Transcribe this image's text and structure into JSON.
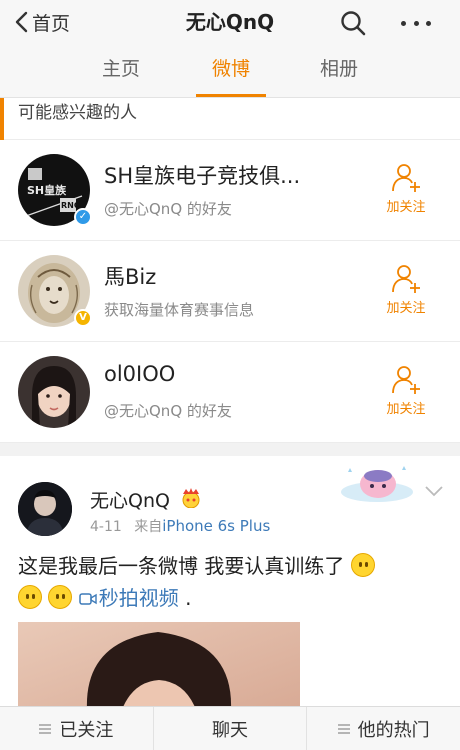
{
  "nav": {
    "back_label": "首页",
    "title": "无心QnQ"
  },
  "tabs": [
    {
      "label": "主页"
    },
    {
      "label": "微博"
    },
    {
      "label": "相册"
    }
  ],
  "suggest": {
    "title": "可能感兴趣的人",
    "follow_label": "加关注",
    "people": [
      {
        "name": "SH皇族电子竞技俱...",
        "subtitle": "@无心QnQ 的好友",
        "verified": "blue"
      },
      {
        "name": "馬Biz",
        "subtitle": "获取海量体育赛事信息",
        "verified": "gold"
      },
      {
        "name": "ol0IOO",
        "subtitle": "@无心QnQ 的好友",
        "verified": "none"
      }
    ],
    "avatar_logo_text": [
      "SH皇族",
      "RNG"
    ]
  },
  "post": {
    "author": "无心QnQ",
    "date": "4-11",
    "source_prefix": "来自",
    "source": "iPhone 6s Plus",
    "text": "这是我最后一条微博 我要认真训练了",
    "video_link": "秒拍视频",
    "trailing": "."
  },
  "bottom": {
    "followed": "已关注",
    "chat": "聊天",
    "hot": "他的热门"
  },
  "colors": {
    "accent": "#f08300",
    "link": "#3d7ab8",
    "verified_blue": "#2f9ae8",
    "verified_gold": "#f5b400"
  }
}
